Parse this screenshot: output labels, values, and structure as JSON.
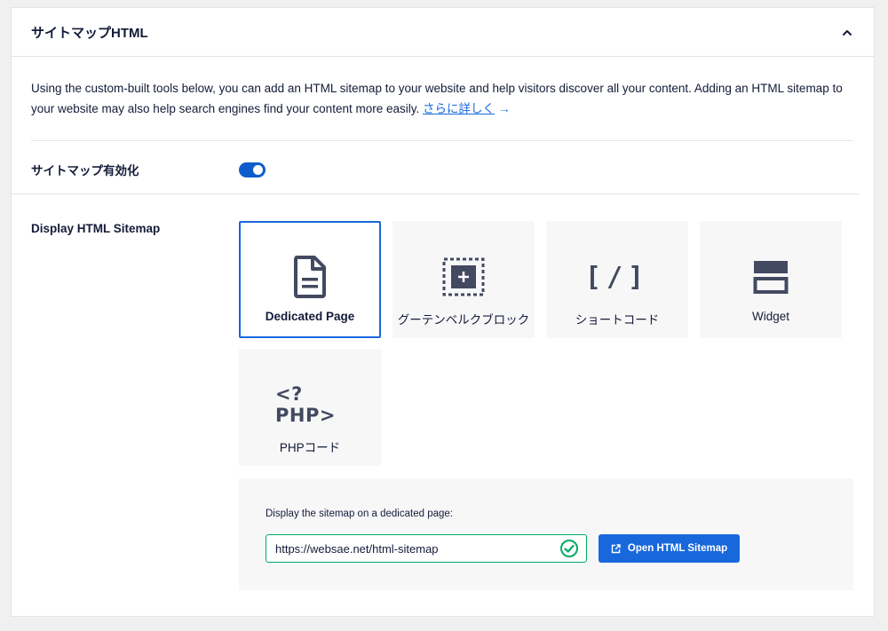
{
  "header": {
    "title": "サイトマップHTML",
    "collapse_icon": "chevron-up-icon"
  },
  "intro": {
    "text": "Using the custom-built tools below, you can add an HTML sitemap to your website and help visitors discover all your content. Adding an HTML sitemap to your website may also help search engines find your content more easily.",
    "link_text": "さらに詳しく",
    "link_arrow": "→"
  },
  "enable": {
    "label": "サイトマップ有効化",
    "enabled": true
  },
  "display": {
    "label": "Display HTML Sitemap",
    "options": [
      {
        "label": "Dedicated Page",
        "icon": "document-icon",
        "selected": true
      },
      {
        "label": "グーテンベルクブロック",
        "icon": "block-add-icon",
        "selected": false
      },
      {
        "label": "ショートコード",
        "icon": "shortcode-icon",
        "glyph": "[/]",
        "selected": false
      },
      {
        "label": "Widget",
        "icon": "widget-icon",
        "selected": false
      },
      {
        "label": "PHPコード",
        "icon": "php-code-icon",
        "glyph": "<?PHP>",
        "selected": false
      }
    ]
  },
  "dedicated": {
    "label": "Display the sitemap on a dedicated page:",
    "url": "https://websae.net/html-sitemap",
    "button_label": "Open HTML Sitemap"
  },
  "colors": {
    "accent": "#1868dc",
    "toggle_on": "#0e5ccc",
    "valid_green": "#00aa63",
    "text_dark": "#141b38",
    "icon_gray": "#434960"
  }
}
